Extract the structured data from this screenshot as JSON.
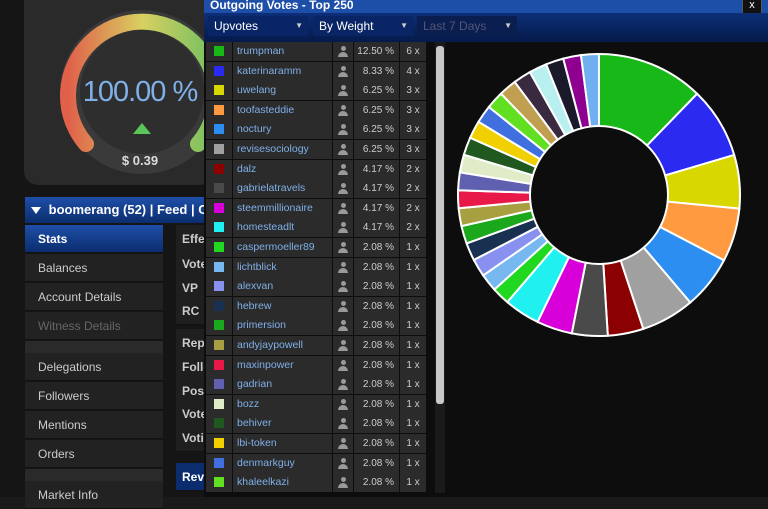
{
  "gauge": {
    "percent_label": "100.00 %",
    "dollar_label": "$ 0.39",
    "level": 1.0
  },
  "userbar": {
    "account": "boomerang (52)",
    "sep1": "|",
    "feed": "Feed",
    "sep2": "|",
    "com": "Com"
  },
  "menu": [
    {
      "label": "Stats",
      "state": "active"
    },
    {
      "label": "Balances",
      "state": "normal"
    },
    {
      "label": "Account Details",
      "state": "normal"
    },
    {
      "label": "Witness Details",
      "state": "disabled"
    },
    {
      "label": "Delegations",
      "state": "normal"
    },
    {
      "label": "Followers",
      "state": "normal"
    },
    {
      "label": "Mentions",
      "state": "normal"
    },
    {
      "label": "Orders",
      "state": "normal"
    },
    {
      "label": "Market Info",
      "state": "normal"
    }
  ],
  "midcol": [
    "Effe",
    "Vote",
    "VP -",
    "RC S",
    "Rep",
    "Follo",
    "Post",
    "Vote",
    "Voti",
    "Rev"
  ],
  "popup": {
    "title": "Outgoing Votes - Top 250",
    "close": "x",
    "dropdown_type": "Upvotes",
    "dropdown_sort": "By Weight",
    "dropdown_period": "Last 7 Days"
  },
  "votes": [
    {
      "name": "trumpman",
      "pct": "12.50 %",
      "count": "6 x",
      "color": "#18b818",
      "weight": 12.5
    },
    {
      "name": "katerinaramm",
      "pct": "8.33 %",
      "count": "4 x",
      "color": "#2a2af0",
      "weight": 8.33
    },
    {
      "name": "uwelang",
      "pct": "6.25 %",
      "count": "3 x",
      "color": "#d8d800",
      "weight": 6.25
    },
    {
      "name": "toofasteddie",
      "pct": "6.25 %",
      "count": "3 x",
      "color": "#ff9a40",
      "weight": 6.25
    },
    {
      "name": "noctury",
      "pct": "6.25 %",
      "count": "3 x",
      "color": "#2b8ef0",
      "weight": 6.25
    },
    {
      "name": "revisesociology",
      "pct": "6.25 %",
      "count": "3 x",
      "color": "#a0a0a0",
      "weight": 6.25
    },
    {
      "name": "dalz",
      "pct": "4.17 %",
      "count": "2 x",
      "color": "#8b0000",
      "weight": 4.17
    },
    {
      "name": "gabrielatravels",
      "pct": "4.17 %",
      "count": "2 x",
      "color": "#4a4a4a",
      "weight": 4.17
    },
    {
      "name": "steemmillionaire",
      "pct": "4.17 %",
      "count": "2 x",
      "color": "#d800d8",
      "weight": 4.17
    },
    {
      "name": "homesteadlt",
      "pct": "4.17 %",
      "count": "2 x",
      "color": "#20f0f0",
      "weight": 4.17
    },
    {
      "name": "caspermoeller89",
      "pct": "2.08 %",
      "count": "1 x",
      "color": "#20d820",
      "weight": 2.08
    },
    {
      "name": "lichtblick",
      "pct": "2.08 %",
      "count": "1 x",
      "color": "#78b8f0",
      "weight": 2.08
    },
    {
      "name": "alexvan",
      "pct": "2.08 %",
      "count": "1 x",
      "color": "#8890f0",
      "weight": 2.08
    },
    {
      "name": "hebrew",
      "pct": "2.08 %",
      "count": "1 x",
      "color": "#1a3050",
      "weight": 2.08
    },
    {
      "name": "primersion",
      "pct": "2.08 %",
      "count": "1 x",
      "color": "#1ca81c",
      "weight": 2.08
    },
    {
      "name": "andyjaypowell",
      "pct": "2.08 %",
      "count": "1 x",
      "color": "#a8a040",
      "weight": 2.08
    },
    {
      "name": "maxinpower",
      "pct": "2.08 %",
      "count": "1 x",
      "color": "#e81848",
      "weight": 2.08
    },
    {
      "name": "gadrian",
      "pct": "2.08 %",
      "count": "1 x",
      "color": "#6060b0",
      "weight": 2.08
    },
    {
      "name": "bozz",
      "pct": "2.08 %",
      "count": "1 x",
      "color": "#e0ecc8",
      "weight": 2.08
    },
    {
      "name": "behiver",
      "pct": "2.08 %",
      "count": "1 x",
      "color": "#205820",
      "weight": 2.08
    },
    {
      "name": "lbi-token",
      "pct": "2.08 %",
      "count": "1 x",
      "color": "#f0d000",
      "weight": 2.08
    },
    {
      "name": "denmarkguy",
      "pct": "2.08 %",
      "count": "1 x",
      "color": "#4070e0",
      "weight": 2.08
    },
    {
      "name": "khaleelkazi",
      "pct": "2.08 %",
      "count": "1 x",
      "color": "#60e020",
      "weight": 2.08
    }
  ],
  "pie_extra": [
    {
      "color": "#c0a050",
      "weight": 2.08
    },
    {
      "color": "#3a2a40",
      "weight": 2.08
    },
    {
      "color": "#b8f0f0",
      "weight": 2.08
    },
    {
      "color": "#1a1a2a",
      "weight": 2.08
    },
    {
      "color": "#900090",
      "weight": 2.08
    },
    {
      "color": "#70b0f0",
      "weight": 2.08
    }
  ]
}
